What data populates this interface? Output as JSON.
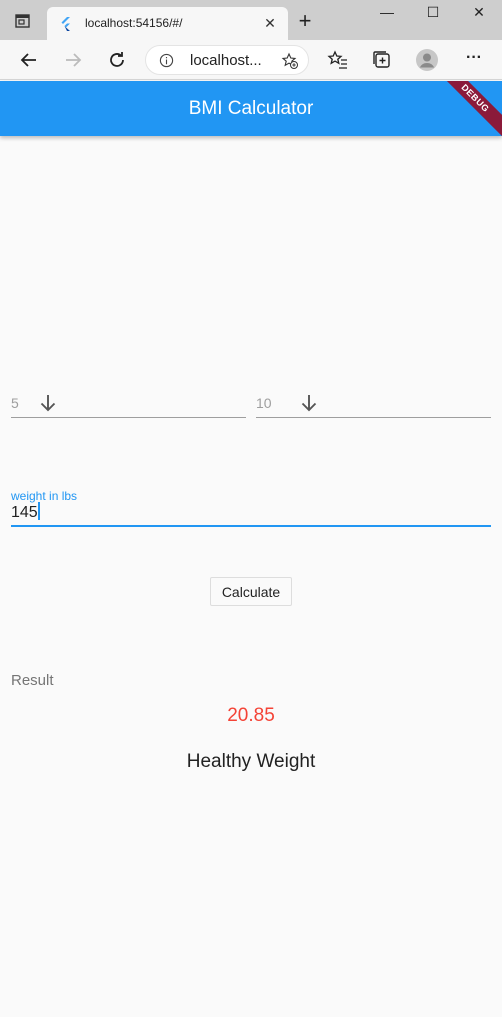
{
  "browser": {
    "tab_title": "localhost:54156/#/",
    "tab_close": "✕",
    "new_tab": "+",
    "address": "localhost...",
    "window_controls": {
      "minimize": "—",
      "maximize": "☐",
      "close": "✕"
    },
    "more": "···"
  },
  "app": {
    "title": "BMI Calculator",
    "debug_banner": "DEBUG",
    "accent_color": "#2196f3"
  },
  "height": {
    "feet_value": "5",
    "inches_value": "10"
  },
  "weight": {
    "label": "weight in lbs",
    "value": "145"
  },
  "calculate_label": "Calculate",
  "result": {
    "label": "Result",
    "bmi": "20.85",
    "category": "Healthy Weight",
    "bmi_color": "#f44336"
  }
}
